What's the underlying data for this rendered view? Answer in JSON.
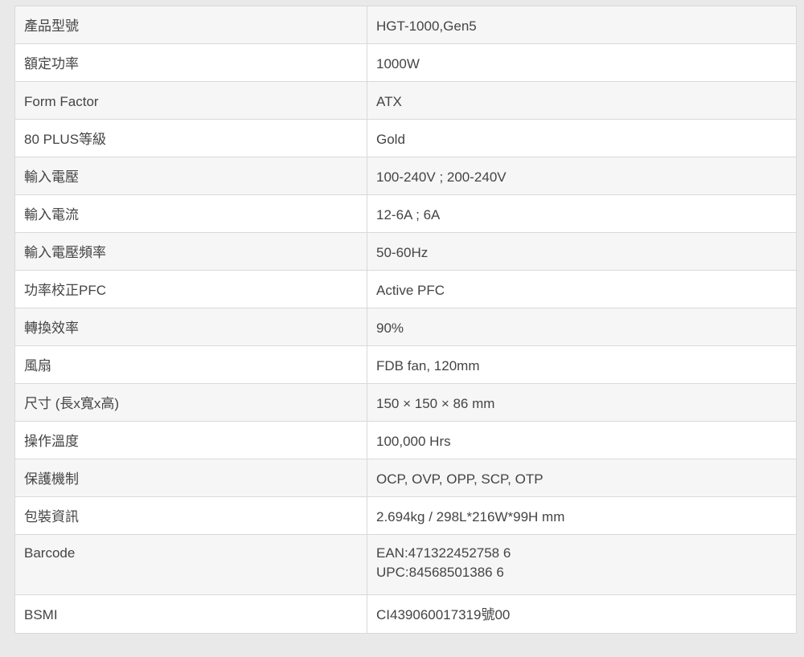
{
  "specs": {
    "rows": [
      {
        "label": "產品型號",
        "value": "HGT-1000,Gen5"
      },
      {
        "label": "額定功率",
        "value": "1000W"
      },
      {
        "label": "Form Factor",
        "value": "ATX"
      },
      {
        "label": "80 PLUS等級",
        "value": "Gold"
      },
      {
        "label": "輸入電壓",
        "value": "100-240V ; 200-240V"
      },
      {
        "label": "輸入電流",
        "value": "12-6A ; 6A"
      },
      {
        "label": "輸入電壓頻率",
        "value": "50-60Hz"
      },
      {
        "label": "功率校正PFC",
        "value": "Active PFC"
      },
      {
        "label": "轉換效率",
        "value": "90%"
      },
      {
        "label": "風扇",
        "value": "FDB fan, 120mm"
      },
      {
        "label": "尺寸 (長x寬x高)",
        "value": "150 × 150 × 86 mm"
      },
      {
        "label": "操作溫度",
        "value": "100,000 Hrs"
      },
      {
        "label": "保護機制",
        "value": "OCP, OVP, OPP, SCP, OTP"
      },
      {
        "label": "包裝資訊",
        "value": "2.694kg / 298L*216W*99H mm"
      },
      {
        "label": "Barcode",
        "value": "EAN:471322452758 6",
        "value2": "UPC:84568501386 6"
      },
      {
        "label": "BSMI",
        "value": "CI439060017319號00"
      }
    ]
  }
}
